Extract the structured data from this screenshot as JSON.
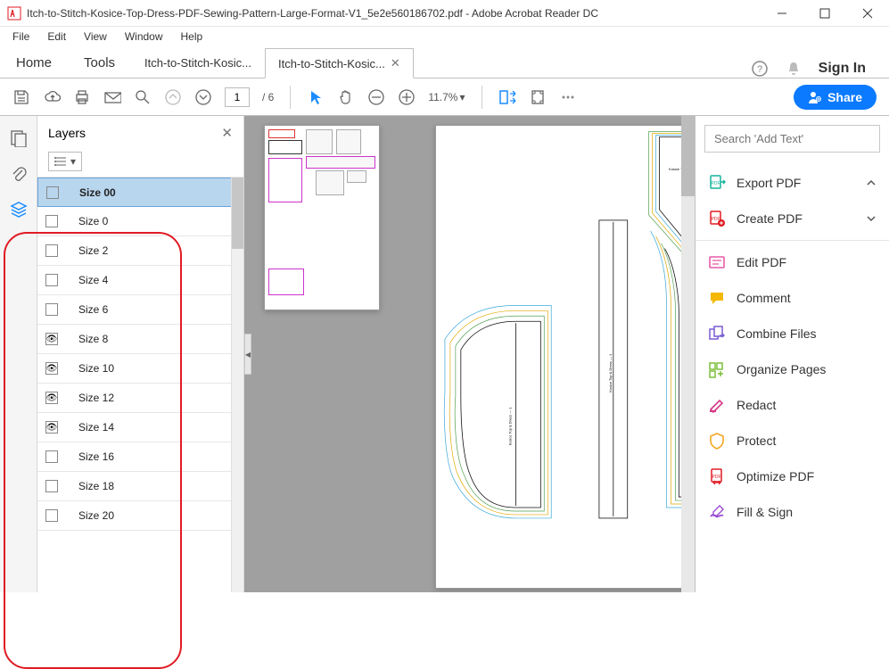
{
  "titlebar": {
    "filename": "Itch-to-Stitch-Kosice-Top-Dress-PDF-Sewing-Pattern-Large-Format-V1_5e2e560186702.pdf",
    "app": "Adobe Acrobat Reader DC"
  },
  "menu": {
    "file": "File",
    "edit": "Edit",
    "view": "View",
    "window": "Window",
    "help": "Help"
  },
  "tabs": {
    "home": "Home",
    "tools": "Tools",
    "doc1": "Itch-to-Stitch-Kosic...",
    "doc2": "Itch-to-Stitch-Kosic...",
    "signin": "Sign In"
  },
  "toolbar": {
    "page_current": "1",
    "page_total": "/ 6",
    "zoom": "11.7%",
    "share": "Share"
  },
  "layers": {
    "title": "Layers",
    "items": [
      {
        "name": "Size 00",
        "visible": false,
        "selected": true
      },
      {
        "name": "Size 0",
        "visible": false,
        "selected": false
      },
      {
        "name": "Size 2",
        "visible": false,
        "selected": false
      },
      {
        "name": "Size 4",
        "visible": false,
        "selected": false
      },
      {
        "name": "Size 6",
        "visible": false,
        "selected": false
      },
      {
        "name": "Size 8",
        "visible": true,
        "selected": false
      },
      {
        "name": "Size 10",
        "visible": true,
        "selected": false
      },
      {
        "name": "Size 12",
        "visible": true,
        "selected": false
      },
      {
        "name": "Size 14",
        "visible": true,
        "selected": false
      },
      {
        "name": "Size 16",
        "visible": false,
        "selected": false
      },
      {
        "name": "Size 18",
        "visible": false,
        "selected": false
      },
      {
        "name": "Size 20",
        "visible": false,
        "selected": false
      }
    ]
  },
  "right": {
    "search_placeholder": "Search 'Add Text'",
    "export": "Export PDF",
    "create": "Create PDF",
    "edit": "Edit PDF",
    "comment": "Comment",
    "combine": "Combine Files",
    "organize": "Organize Pages",
    "redact": "Redact",
    "protect": "Protect",
    "optimize": "Optimize PDF",
    "fillsign": "Fill & Sign"
  },
  "colors": {
    "accent_blue": "#0b7aff",
    "annotation_red": "#e01b24"
  }
}
